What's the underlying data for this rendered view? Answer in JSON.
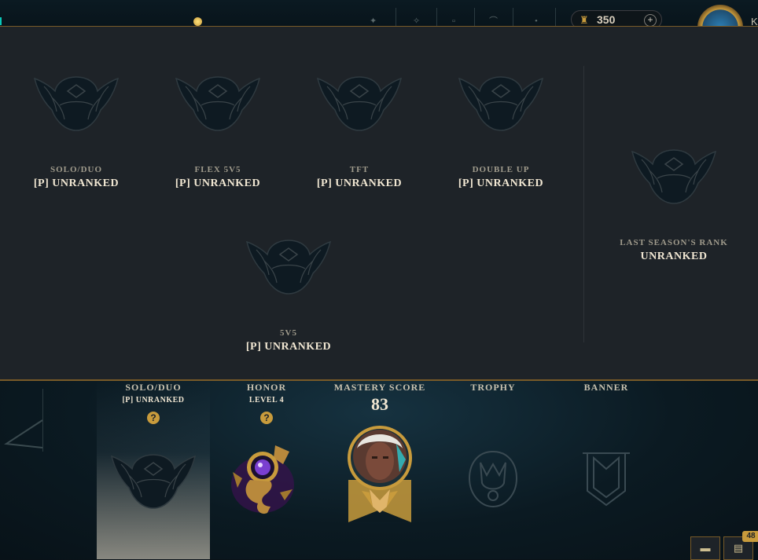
{
  "topbar": {
    "currency": {
      "icon": "blue-essence-icon",
      "value": "350",
      "plus_label": "+"
    },
    "summoner_initial": "K"
  },
  "rank_panel": {
    "queues": [
      {
        "label": "SOLO/DUO",
        "rank": "[P] UNRANKED"
      },
      {
        "label": "FLEX 5V5",
        "rank": "[P] UNRANKED"
      },
      {
        "label": "TFT",
        "rank": "[P] UNRANKED"
      },
      {
        "label": "DOUBLE UP",
        "rank": "[P] UNRANKED"
      },
      {
        "label": "5V5",
        "rank": "[P] UNRANKED"
      }
    ],
    "last_season": {
      "label": "LAST SEASON'S RANK",
      "rank": "UNRANKED"
    }
  },
  "profile_stats": {
    "solo": {
      "title": "SOLO/DUO",
      "sub": "[P] UNRANKED",
      "help": "?"
    },
    "honor": {
      "title": "HONOR",
      "sub": "LEVEL 4",
      "help": "?"
    },
    "mastery": {
      "title": "MASTERY SCORE",
      "value": "83"
    },
    "trophy": {
      "title": "TROPHY"
    },
    "banner": {
      "title": "BANNER"
    }
  },
  "social": {
    "notification_count": "48"
  },
  "colors": {
    "gold": "#c89b3c",
    "panel_bg": "#1e2328",
    "text_light": "#f0e6d2",
    "text_muted": "#a09b8c"
  }
}
